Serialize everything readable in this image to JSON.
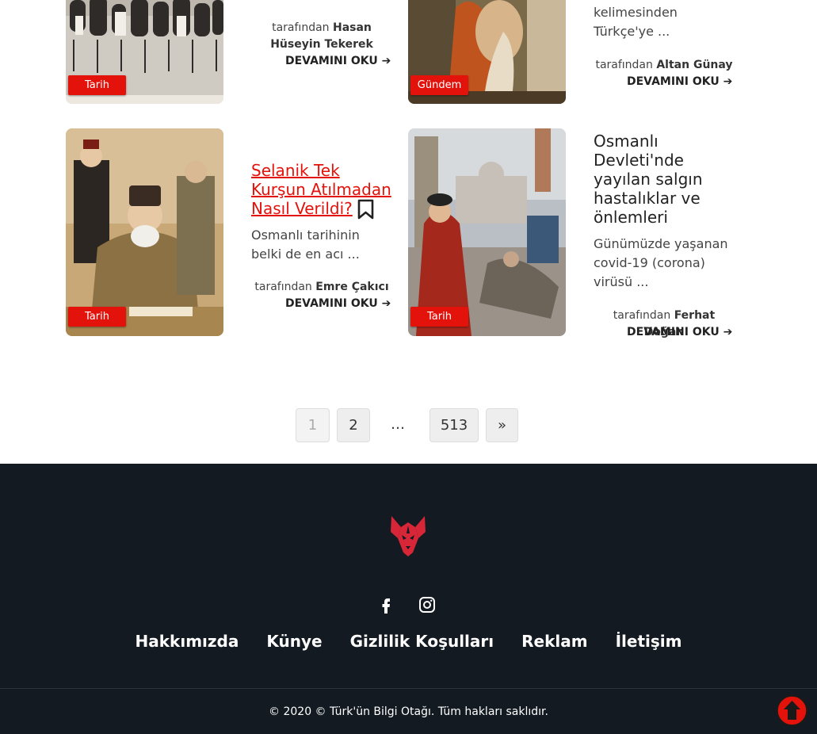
{
  "posts": [
    {
      "category": "Tarih",
      "author_prefix": "tarafından",
      "author": "Hasan Hüseyin Tekerek",
      "read_more": "DEVAMINI OKU"
    },
    {
      "category": "Gündem",
      "excerpt_tail": "kelimesinden Türkçe'ye ...",
      "author_prefix": "tarafından",
      "author": "Altan Günay",
      "read_more": "DEVAMINI OKU"
    },
    {
      "category": "Tarih",
      "title": "Selanik Tek Kurşun Atılmadan Nasıl Verildi?",
      "excerpt": "Osmanlı tarihinin belki de en acı ...",
      "author_prefix": "tarafından",
      "author": "Emre Çakıcı",
      "read_more": "DEVAMINI OKU"
    },
    {
      "category": "Tarih",
      "title": "Osmanlı Devleti'nde yayılan salgın hastalıklar ve önlemleri",
      "excerpt": "Günümüzde yaşanan covid-19 (corona) virüsü ...",
      "author_prefix": "tarafından",
      "author": "Ferhat Doğan",
      "read_more": "DEVAMINI OKU"
    }
  ],
  "pagination": {
    "pages": [
      "1",
      "2",
      "…",
      "513",
      "»"
    ],
    "current": "1"
  },
  "footer": {
    "nav": [
      "Hakkımızda",
      "Künye",
      "Gizlilik Koşulları",
      "Reklam",
      "İletişim"
    ],
    "social": [
      "facebook-icon",
      "instagram-icon"
    ],
    "copyright": "© 2020 © Türk'ün Bilgi Otağı. Tüm hakları saklıdır."
  },
  "colors": {
    "accent": "#e3120b",
    "footer_bg": "#131a22"
  }
}
